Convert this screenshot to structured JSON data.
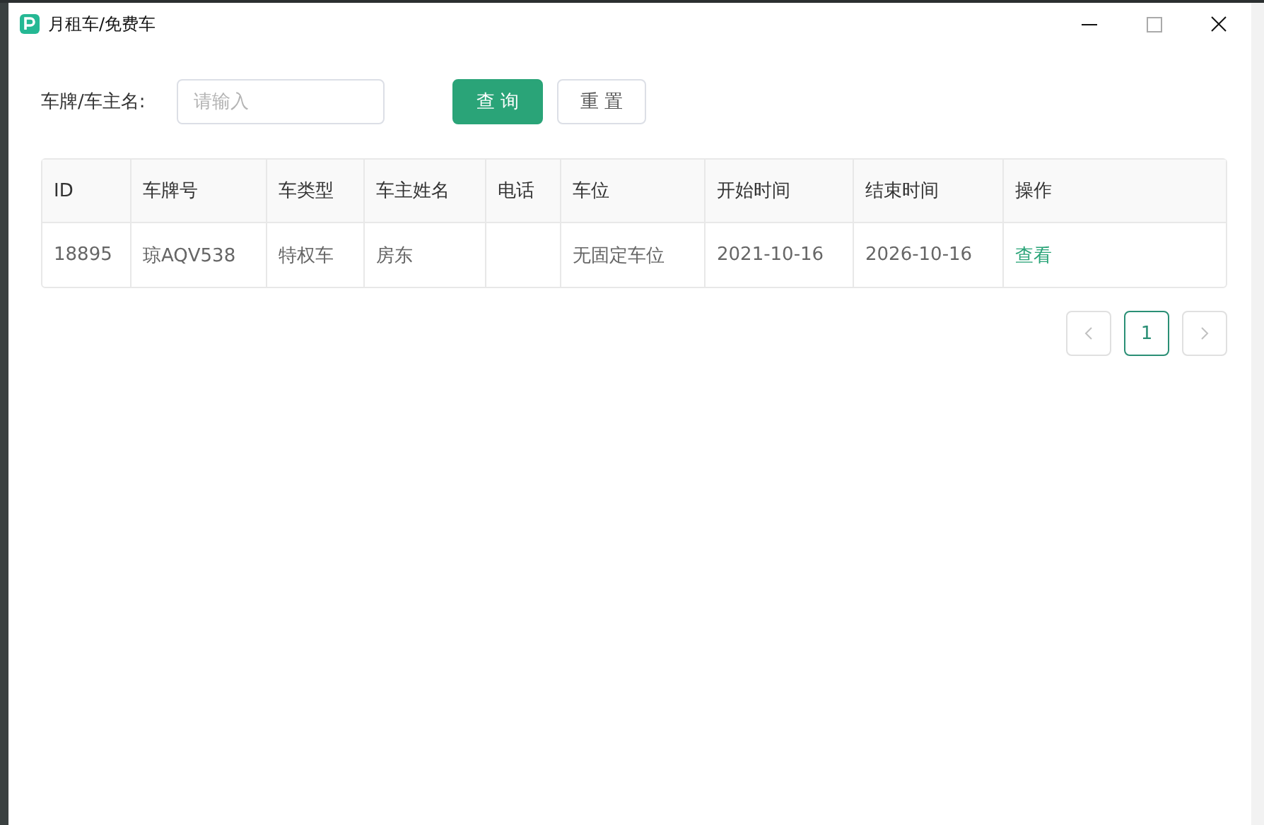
{
  "window": {
    "title": "月租车/免费车"
  },
  "search": {
    "label": "车牌/车主名:",
    "placeholder": "请输入"
  },
  "buttons": [
    {
      "label": "查 询",
      "kind": "primary"
    },
    {
      "label": "重 置",
      "kind": "default"
    }
  ],
  "table": {
    "columns": [
      "ID",
      "车牌号",
      "车类型",
      "车主姓名",
      "电话",
      "车位",
      "开始时间",
      "结束时间",
      "操作"
    ],
    "rows": [
      {
        "cells": [
          "18895",
          "琼AQV538",
          "特权车",
          "房东",
          "",
          "无固定车位",
          "2021-10-16",
          "2026-10-16"
        ],
        "action": "查看"
      }
    ]
  },
  "pagination": {
    "pages": [
      {
        "label": "1",
        "selected": true
      }
    ]
  }
}
